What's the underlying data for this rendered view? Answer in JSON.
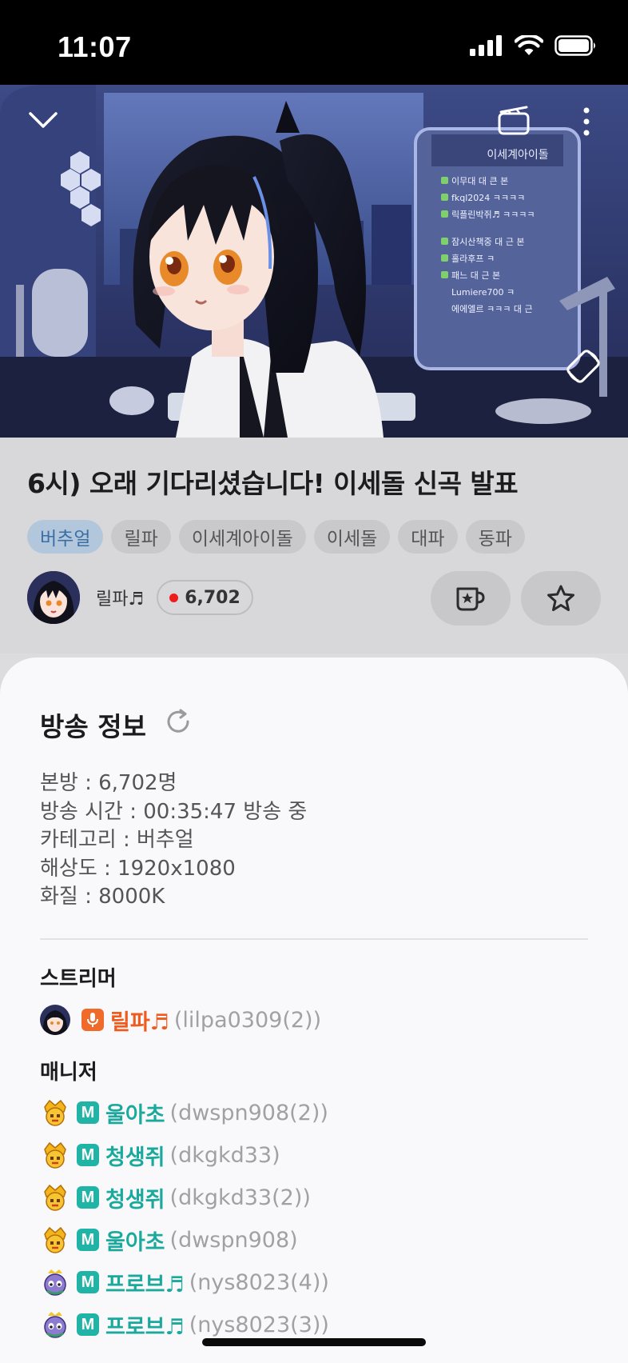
{
  "status": {
    "time": "11:07"
  },
  "video": {
    "overlay_chat": [
      "이무대 대 큰 본",
      "fkql2024 ㅋㅋㅋㅋ",
      "릭플린박쥐♬ ㅋㅋㅋㅋ",
      "잠시산책중 대 근 본",
      "홀라후프 ㅋ",
      "패느 대 근 본",
      "Lumiere700 ㅋ",
      "에에엘르 ㅋㅋㅋ 대 근"
    ],
    "sign_text": "이세계아이돌"
  },
  "broadcast": {
    "title": "6시) 오래 기다리셨습니다! 이세돌 신곡 발표",
    "tags": [
      "버추얼",
      "릴파",
      "이세계아이돌",
      "이세돌",
      "대파",
      "동파"
    ],
    "streamer_name": "릴파♬",
    "viewer_count": "6,702"
  },
  "info_sheet": {
    "title": "방송 정보",
    "stats": [
      "본방 : 6,702명",
      "방송 시간 : 00:35:47 방송 중",
      "카테고리 : 버추얼",
      "해상도 : 1920x1080",
      "화질 : 8000K"
    ],
    "streamer_heading": "스트리머",
    "streamer": {
      "name": "릴파♬",
      "id": "(lilpa0309(2))"
    },
    "manager_heading": "매니저",
    "manager_badge": "M",
    "managers": [
      {
        "name": "울아초",
        "id": "(dwspn908(2))",
        "avatar": "gold-crown"
      },
      {
        "name": "청생쥐",
        "id": "(dkgkd33)",
        "avatar": "gold-crown"
      },
      {
        "name": "청생쥐",
        "id": "(dkgkd33(2))",
        "avatar": "gold-crown"
      },
      {
        "name": "울아초",
        "id": "(dwspn908)",
        "avatar": "gold-crown"
      },
      {
        "name": "프로브♬",
        "id": "(nys8023(4))",
        "avatar": "purple-character"
      },
      {
        "name": "프로브♬",
        "id": "(nys8023(3))",
        "avatar": "purple-character"
      }
    ]
  },
  "colors": {
    "accent_teal": "#1aa99c",
    "streamer_orange": "#ef5a1d",
    "live_red": "#ef1c1c",
    "tag_primary_text": "#3a6fa6"
  },
  "icons": [
    "signal-icon",
    "wifi-icon",
    "battery-icon",
    "chevron-down-icon",
    "clapperboard-icon",
    "more-vertical-icon",
    "rotate-screen-icon",
    "refresh-icon",
    "mic-icon",
    "cup-star-icon",
    "star-icon"
  ]
}
